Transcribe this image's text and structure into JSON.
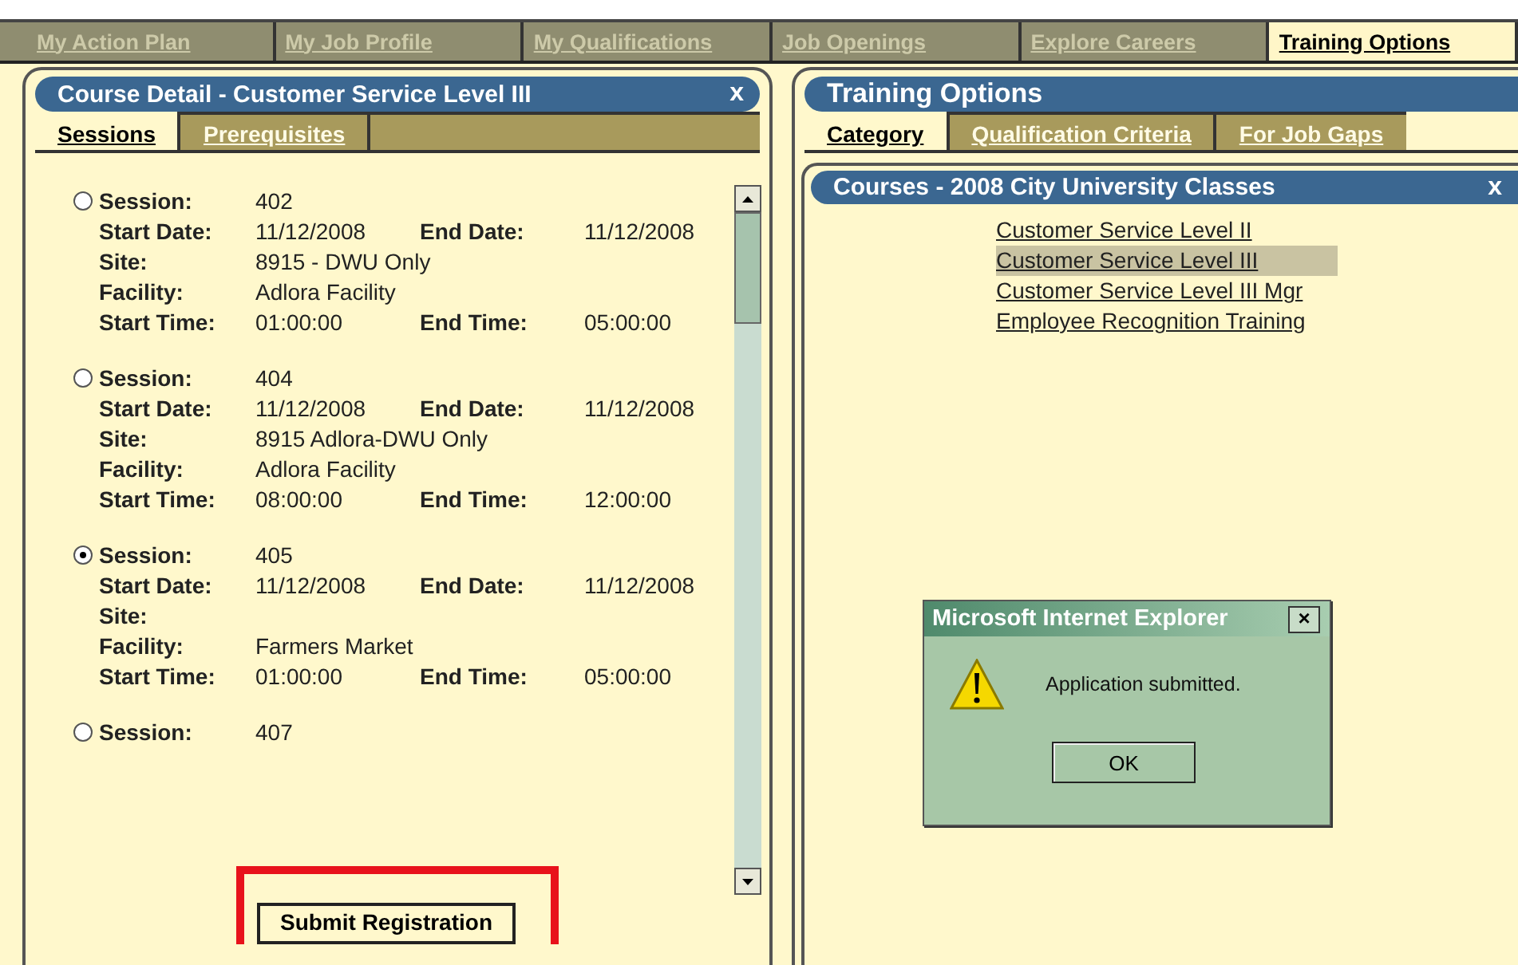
{
  "top_tabs": [
    {
      "label": "My Action Plan",
      "selected": false
    },
    {
      "label": "My Job Profile",
      "selected": false
    },
    {
      "label": "My Qualifications",
      "selected": false
    },
    {
      "label": "Job Openings",
      "selected": false
    },
    {
      "label": "Explore Careers",
      "selected": false
    },
    {
      "label": "Training Options",
      "selected": true
    }
  ],
  "course_detail": {
    "title": "Course Detail - Customer Service Level III",
    "close": "x",
    "tabs": [
      {
        "label": "Sessions",
        "selected": true
      },
      {
        "label": "Prerequisites",
        "selected": false
      }
    ],
    "sessions": [
      {
        "selected": false,
        "rows": [
          {
            "cells": [
              {
                "label": "Session:",
                "value": "402"
              }
            ]
          },
          {
            "cells": [
              {
                "label": "Start Date:",
                "value": "11/12/2008"
              },
              {
                "label": "End Date:",
                "value": "11/12/2008"
              }
            ]
          },
          {
            "cells": [
              {
                "label": "Site:",
                "value": "8915 - DWU Only"
              }
            ]
          },
          {
            "cells": [
              {
                "label": "Facility:",
                "value": "Adlora Facility"
              }
            ]
          },
          {
            "cells": [
              {
                "label": "Start Time:",
                "value": "01:00:00"
              },
              {
                "label": "End Time:",
                "value": "05:00:00"
              }
            ]
          }
        ]
      },
      {
        "selected": false,
        "rows": [
          {
            "cells": [
              {
                "label": "Session:",
                "value": "404"
              }
            ]
          },
          {
            "cells": [
              {
                "label": "Start Date:",
                "value": "11/12/2008"
              },
              {
                "label": "End Date:",
                "value": "11/12/2008"
              }
            ]
          },
          {
            "cells": [
              {
                "label": "Site:",
                "value": "8915 Adlora-DWU Only"
              }
            ]
          },
          {
            "cells": [
              {
                "label": "Facility:",
                "value": "Adlora Facility"
              }
            ]
          },
          {
            "cells": [
              {
                "label": "Start Time:",
                "value": "08:00:00"
              },
              {
                "label": "End Time:",
                "value": "12:00:00"
              }
            ]
          }
        ]
      },
      {
        "selected": true,
        "rows": [
          {
            "cells": [
              {
                "label": "Session:",
                "value": "405"
              }
            ]
          },
          {
            "cells": [
              {
                "label": "Start Date:",
                "value": "11/12/2008"
              },
              {
                "label": "End Date:",
                "value": "11/12/2008"
              }
            ]
          },
          {
            "cells": [
              {
                "label": "Site:"
              }
            ]
          },
          {
            "cells": [
              {
                "label": "Facility:",
                "value": "Farmers Market"
              }
            ]
          },
          {
            "cells": [
              {
                "label": "Start Time:",
                "value": "01:00:00"
              },
              {
                "label": "End Time:",
                "value": "05:00:00"
              }
            ]
          }
        ]
      },
      {
        "selected": false,
        "rows": [
          {
            "cells": [
              {
                "label": "Session:",
                "value": "407"
              }
            ]
          }
        ]
      }
    ],
    "submit": {
      "label": "Submit Registration",
      "highlighted": true
    }
  },
  "training_options": {
    "title": "Training Options",
    "tabs": [
      {
        "label": "Category",
        "selected": true
      },
      {
        "label": "Qualification Criteria",
        "selected": false
      },
      {
        "label": "For Job Gaps",
        "selected": false
      }
    ],
    "courses": {
      "title": "Courses - 2008 City University Classes",
      "close": "x",
      "items": [
        {
          "label": "Customer Service Level II",
          "selected": false
        },
        {
          "label": "Customer Service Level III",
          "selected": true
        },
        {
          "label": "Customer Service Level III Mgr",
          "selected": false
        },
        {
          "label": "Employee Recognition Training",
          "selected": false
        }
      ]
    }
  },
  "dialog": {
    "title": "Microsoft Internet Explorer",
    "close": "×",
    "message": "Application submitted.",
    "button": "OK"
  }
}
